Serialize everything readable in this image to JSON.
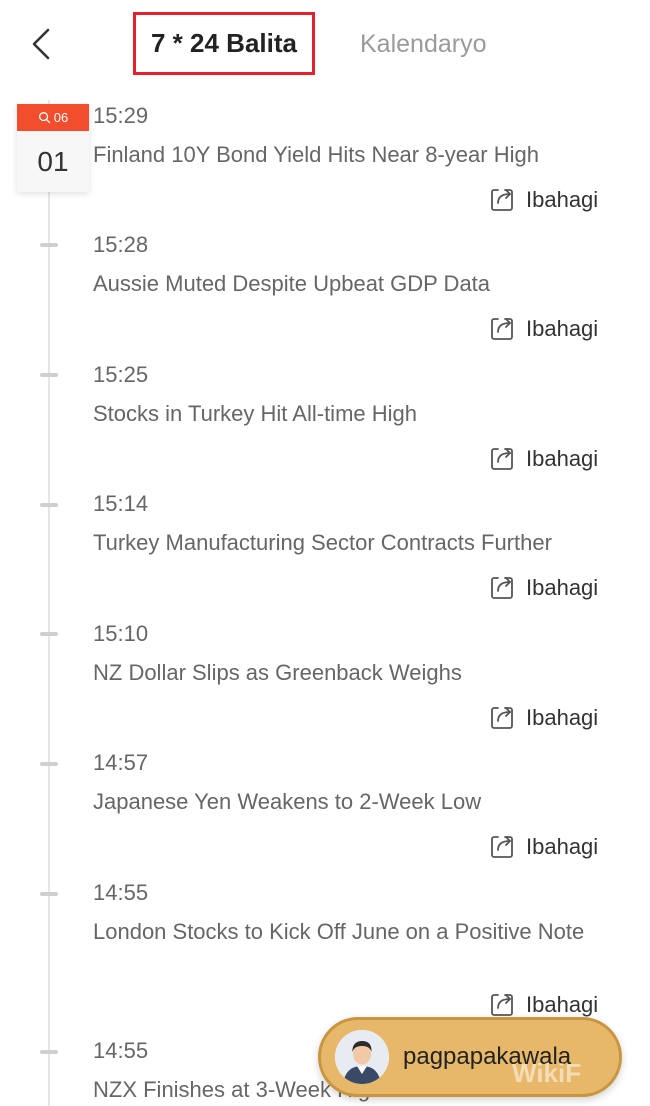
{
  "header": {
    "back_icon": "chevron-left-icon",
    "tabs": [
      {
        "label": "7 * 24 Balita",
        "active": true
      },
      {
        "label": "Kalendaryo",
        "active": false
      }
    ]
  },
  "date_badge": {
    "month_label": "06",
    "day": "01",
    "accent_color": "#f24e2e"
  },
  "news": [
    {
      "time": "15:29",
      "title": "Finland 10Y Bond Yield Hits Near 8-year High",
      "share_label": "Ibahagi"
    },
    {
      "time": "15:28",
      "title": "Aussie Muted Despite Upbeat GDP Data",
      "share_label": "Ibahagi"
    },
    {
      "time": "15:25",
      "title": "Stocks in Turkey Hit All-time High",
      "share_label": "Ibahagi"
    },
    {
      "time": "15:14",
      "title": "Turkey Manufacturing Sector Contracts Further",
      "share_label": "Ibahagi"
    },
    {
      "time": "15:10",
      "title": "NZ Dollar Slips as Greenback Weighs",
      "share_label": "Ibahagi"
    },
    {
      "time": "14:57",
      "title": "Japanese Yen Weakens to 2-Week Low",
      "share_label": "Ibahagi"
    },
    {
      "time": "14:55",
      "title": "London Stocks to Kick Off June on a Positive Note",
      "share_label": "Ibahagi"
    },
    {
      "time": "14:55",
      "title": "NZX Finishes at 3-Week High"
    }
  ],
  "floating_button": {
    "label": "pagpapakawala",
    "icon": "avatar-icon"
  },
  "watermark": "WikiF"
}
